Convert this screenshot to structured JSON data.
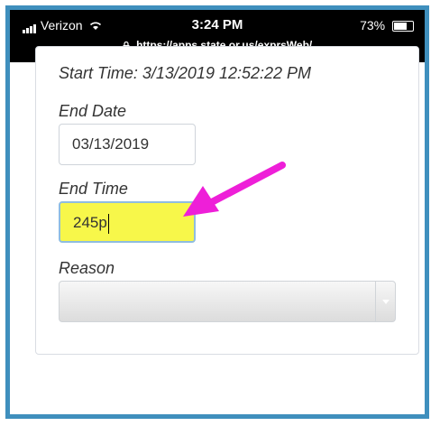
{
  "status_bar": {
    "carrier": "Verizon",
    "time": "3:24 PM",
    "battery": "73%",
    "battery_level": 0.73,
    "url": "https://apps.state.or.us/exprsWeb/"
  },
  "form": {
    "start_time_label": "Start Time:",
    "start_time_value": "3/13/2019 12:52:22 PM",
    "end_date_label": "End Date",
    "end_date_value": "03/13/2019",
    "end_time_label": "End Time",
    "end_time_value": "245p",
    "reason_label": "Reason",
    "reason_value": ""
  },
  "colors": {
    "frame_border": "#3f8fbd",
    "highlight_fill": "#f7f74a",
    "annotation_arrow": "#ee1fd8"
  },
  "icons": [
    "signal-icon",
    "wifi-icon",
    "lock-icon",
    "battery-icon",
    "dropdown-arrow-icon",
    "annotation-arrow"
  ]
}
